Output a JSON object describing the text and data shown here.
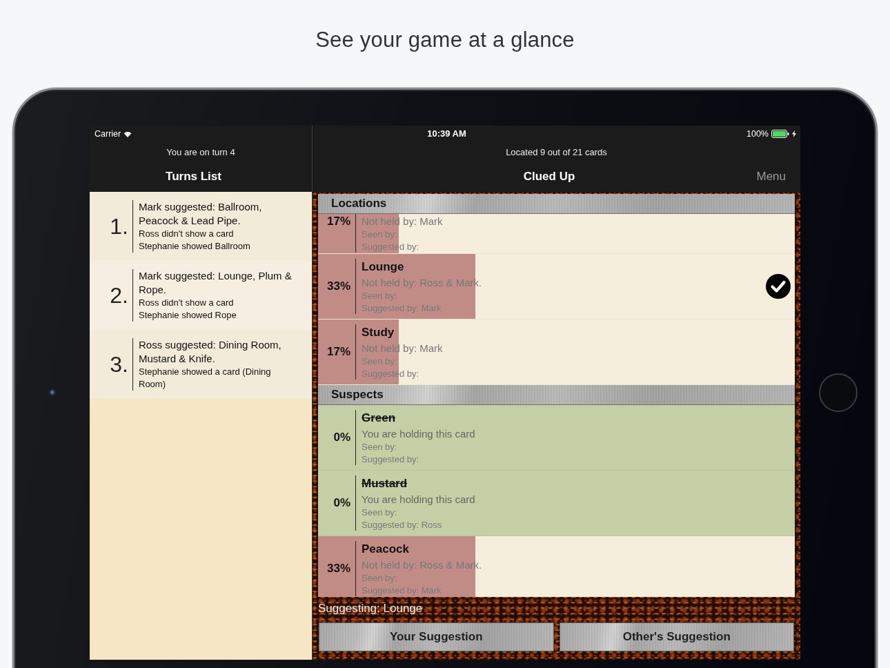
{
  "headline": "See your game at a glance",
  "status_bar": {
    "carrier": "Carrier",
    "time": "10:39 AM",
    "battery": "100%"
  },
  "turns_panel": {
    "prompt": "You are on turn 4",
    "title": "Turns List",
    "turns": [
      {
        "number": "1.",
        "summary": "Mark suggested: Ballroom, Peacock & Lead Pipe.",
        "details": [
          "Ross didn't show a card",
          "Stephanie showed Ballroom"
        ]
      },
      {
        "number": "2.",
        "summary": "Mark suggested: Lounge, Plum & Rope.",
        "details": [
          "Ross didn't show a card",
          "Stephanie showed Rope"
        ]
      },
      {
        "number": "3.",
        "summary": "Ross suggested: Dining Room, Mustard & Knife.",
        "details": [
          "Stephanie showed a card (Dining Room)"
        ]
      }
    ]
  },
  "cards_panel": {
    "prompt": "Located 9 out of 21 cards",
    "title": "Clued Up",
    "menu": "Menu",
    "sections": [
      {
        "title": "Locations",
        "cards": [
          {
            "percent": "17%",
            "level": 0.17,
            "held": false,
            "selected": false,
            "note": "Not held by: Mark",
            "seen_by": "Seen by:",
            "suggested_by": "Suggested by:"
          },
          {
            "name": "Lounge",
            "percent": "33%",
            "level": 0.33,
            "held": false,
            "selected": true,
            "note": "Not held by: Ross & Mark.",
            "seen_by": "Seen by:",
            "suggested_by": "Suggested by: Mark"
          },
          {
            "name": "Study",
            "percent": "17%",
            "level": 0.17,
            "held": false,
            "selected": false,
            "note": "Not held by: Mark",
            "seen_by": "Seen by:",
            "suggested_by": "Suggested by:"
          }
        ]
      },
      {
        "title": "Suspects",
        "cards": [
          {
            "name": "Green",
            "percent": "0%",
            "held": true,
            "selected": false,
            "note": "You are holding this card",
            "seen_by": "Seen by:",
            "suggested_by": "Suggested by:"
          },
          {
            "name": "Mustard",
            "percent": "0%",
            "held": true,
            "selected": false,
            "note": "You are holding this card",
            "seen_by": "Seen by:",
            "suggested_by": "Suggested by: Ross"
          },
          {
            "name": "Peacock",
            "percent": "33%",
            "level": 0.33,
            "held": false,
            "selected": false,
            "note": "Not held by: Ross & Mark.",
            "seen_by": "Seen by:",
            "suggested_by": "Suggested by: Mark"
          }
        ]
      }
    ],
    "suggesting": "Suggesting: Lounge",
    "buttons": [
      "Your Suggestion",
      "Other's Suggestion"
    ]
  }
}
